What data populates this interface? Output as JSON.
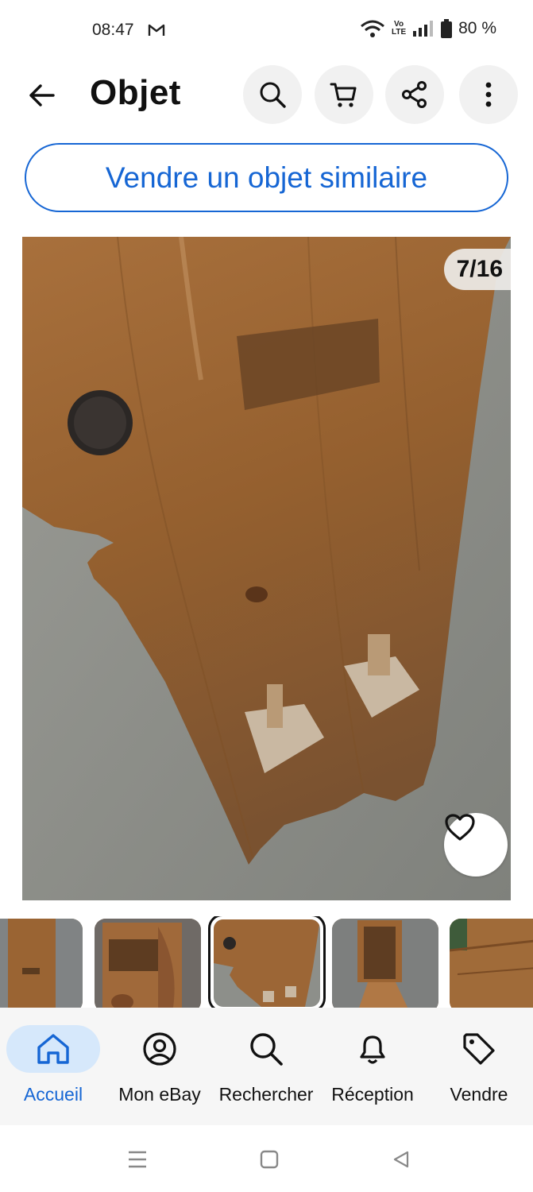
{
  "status_bar": {
    "time": "08:47",
    "battery": "80 %",
    "network_label_top": "Vo",
    "network_label_bottom": "LTE"
  },
  "header": {
    "title": "Objet"
  },
  "actions": {
    "sell_similar_label": "Vendre un objet similaire"
  },
  "gallery": {
    "counter": "7/16",
    "thumbnail_count_visible": 5,
    "selected_index": 2
  },
  "bottom_nav": {
    "items": [
      {
        "label": "Accueil",
        "icon": "home-icon",
        "active": true
      },
      {
        "label": "Mon eBay",
        "icon": "user-circle-icon",
        "active": false
      },
      {
        "label": "Rechercher",
        "icon": "search-icon",
        "active": false
      },
      {
        "label": "Réception",
        "icon": "bell-icon",
        "active": false
      },
      {
        "label": "Vendre",
        "icon": "tag-icon",
        "active": false
      }
    ]
  },
  "colors": {
    "accent": "#1666d4",
    "active_nav_bg": "#d6e8fb",
    "circle_button_bg": "#f1f1f1"
  }
}
